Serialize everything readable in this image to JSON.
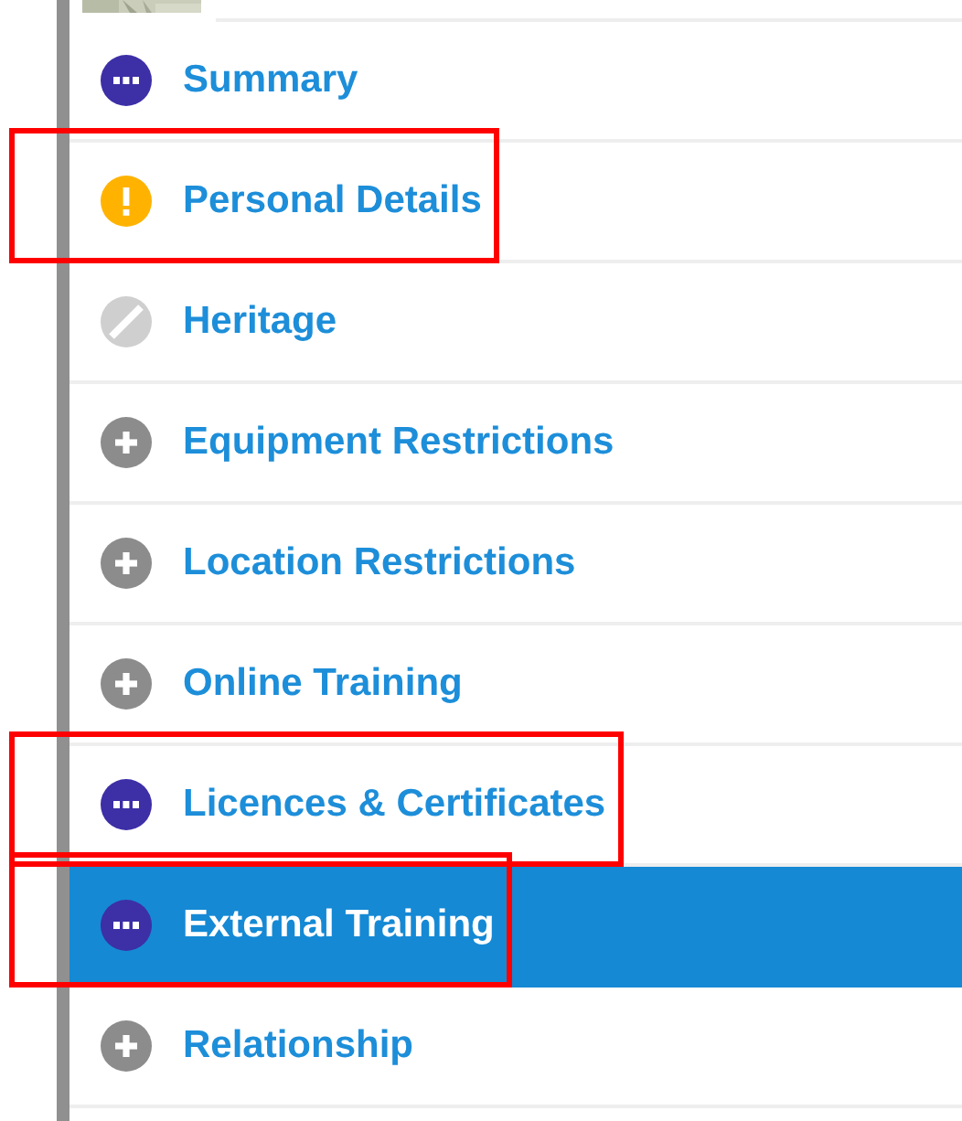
{
  "sections": [
    {
      "label": "Summary",
      "kind": "incomplete",
      "selected": false,
      "marked": false
    },
    {
      "label": "Personal Details",
      "kind": "warning",
      "selected": false,
      "marked": true
    },
    {
      "label": "Heritage",
      "kind": "unavailable",
      "selected": false,
      "marked": false
    },
    {
      "label": "Equipment Restrictions",
      "kind": "empty",
      "selected": false,
      "marked": false
    },
    {
      "label": "Location Restrictions",
      "kind": "empty",
      "selected": false,
      "marked": false
    },
    {
      "label": "Online Training",
      "kind": "empty",
      "selected": false,
      "marked": false
    },
    {
      "label": "Licences & Certificates",
      "kind": "incomplete",
      "selected": false,
      "marked": true
    },
    {
      "label": "External Training",
      "kind": "incomplete",
      "selected": true,
      "marked": true
    },
    {
      "label": "Relationship",
      "kind": "empty",
      "selected": false,
      "marked": false
    }
  ]
}
